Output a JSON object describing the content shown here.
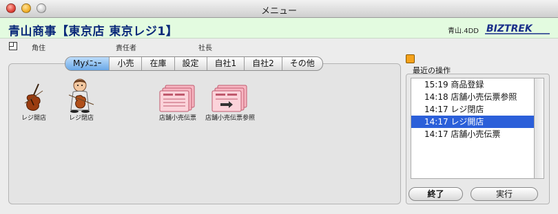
{
  "window": {
    "title": "メニュー"
  },
  "header": {
    "company": "青山商事【東京店 東京レジ1】",
    "db_name": "青山.4DD",
    "logo_text": "BIZTREK",
    "logo_color": "#1a2f8a",
    "band_color": "#e3fbe0"
  },
  "info": {
    "labels": [
      "角住",
      "責任者",
      "社長"
    ]
  },
  "tabs": [
    {
      "label": "Myﾒﾆｭｰ",
      "active": true
    },
    {
      "label": "小売"
    },
    {
      "label": "在庫"
    },
    {
      "label": "設定"
    },
    {
      "label": "自社1"
    },
    {
      "label": "自社2"
    },
    {
      "label": "その他"
    }
  ],
  "menu_items": [
    {
      "label": "レジ開店",
      "icon": "violin-icon"
    },
    {
      "label": "レジ閉店",
      "icon": "violinist-icon"
    },
    {
      "label": "店舗小売伝票",
      "icon": "document-stack-icon"
    },
    {
      "label": "店舗小売伝票参照",
      "icon": "document-stack-arrow-icon"
    }
  ],
  "recent": {
    "title": "最近の操作",
    "items": [
      "15:19 商品登録",
      "14:18 店舗小売伝票参照",
      "14:17 レジ閉店",
      "14:17 レジ開店",
      "14:17 店舗小売伝票"
    ],
    "selected_index": 3
  },
  "buttons": {
    "end": "終了",
    "run": "実行"
  },
  "colors": {
    "selection": "#2b5fd9",
    "tab_active": "#6aa8e8",
    "recent_icon": "#f5a21b"
  }
}
